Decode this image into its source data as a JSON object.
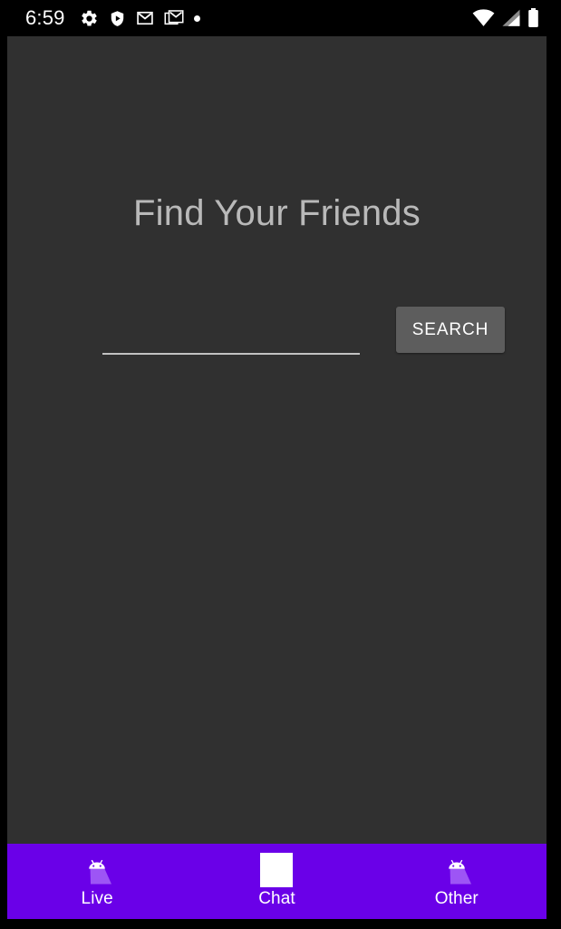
{
  "status_bar": {
    "time": "6:59",
    "icons_left": [
      {
        "name": "settings-gear-icon",
        "glyph": "gear"
      },
      {
        "name": "play-protect-shield-icon",
        "glyph": "shield-play"
      },
      {
        "name": "gmail-icon",
        "glyph": "gmail"
      },
      {
        "name": "gmail-stacked-icon",
        "glyph": "gmail-stacked"
      },
      {
        "name": "more-notifications-dot-icon",
        "glyph": "dot"
      }
    ],
    "icons_right": [
      {
        "name": "wifi-icon",
        "glyph": "wifi"
      },
      {
        "name": "cell-signal-icon",
        "glyph": "signal"
      },
      {
        "name": "battery-icon",
        "glyph": "battery"
      }
    ]
  },
  "main": {
    "title": "Find Your Friends",
    "search": {
      "value": "",
      "placeholder": "",
      "button_label": "SEARCH"
    }
  },
  "bottom_nav": {
    "items": [
      {
        "label": "Live",
        "icon": "android-robot-icon",
        "selected": false
      },
      {
        "label": "Chat",
        "icon": "white-square-icon",
        "selected": true
      },
      {
        "label": "Other",
        "icon": "android-robot-icon",
        "selected": false
      }
    ]
  },
  "colors": {
    "app_background": "#303030",
    "status_bar_background": "#000000",
    "nav_background": "#6a00e8",
    "title_text": "#b9b9b9",
    "search_button_background": "#5d5d5d",
    "nav_label_text": "#ffffff"
  }
}
